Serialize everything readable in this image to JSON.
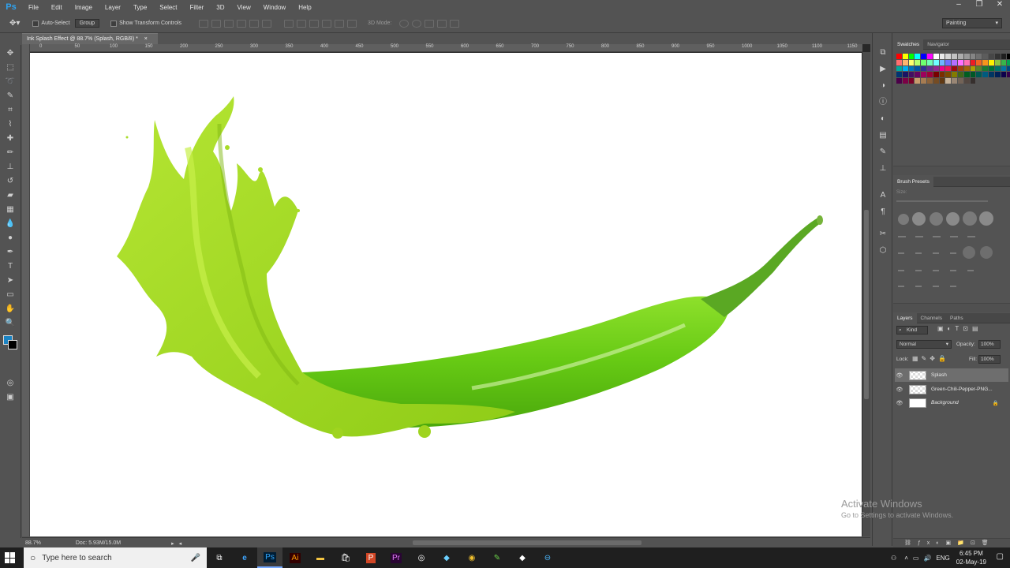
{
  "menubar": {
    "app_logo": "Ps",
    "items": [
      "File",
      "Edit",
      "Image",
      "Layer",
      "Type",
      "Select",
      "Filter",
      "3D",
      "View",
      "Window",
      "Help"
    ],
    "window_controls": [
      "–",
      "❐",
      "✕"
    ]
  },
  "options": {
    "auto_select_label": "Auto-Select",
    "group_value": "Group",
    "show_transform_label": "Show Transform Controls",
    "mode_3d_label": "3D Mode:",
    "workspace": "Painting"
  },
  "document": {
    "tab_title": "Ink Splash Effect @ 88.7% (Splash, RGB/8) *",
    "ruler_ticks": [
      "0",
      "50",
      "100",
      "150",
      "200",
      "250",
      "300",
      "350",
      "400",
      "450",
      "500",
      "550",
      "600",
      "650",
      "700",
      "750",
      "800",
      "850",
      "900",
      "950",
      "1000",
      "1050",
      "1100",
      "1150"
    ],
    "zoom": "88.7%",
    "doc_info": "Doc: 5.93M/15.0M"
  },
  "swatches": {
    "tabs": [
      "Swatches",
      "Navigator"
    ],
    "colors": [
      "#ff0000",
      "#ffff00",
      "#00ff00",
      "#00ffff",
      "#0000ff",
      "#ff00ff",
      "#ffffff",
      "#eaeaea",
      "#d6d6d6",
      "#c2c2c2",
      "#adadad",
      "#999999",
      "#858585",
      "#707070",
      "#5c5c5c",
      "#474747",
      "#333333",
      "#1f1f1f",
      "#000000",
      "#ff6f6f",
      "#ffb46f",
      "#ffff6f",
      "#b4ff6f",
      "#6fff6f",
      "#6fffb4",
      "#6fffff",
      "#6fb4ff",
      "#6f6fff",
      "#b46fff",
      "#ff6fff",
      "#ff6fb4",
      "#ed1c24",
      "#f26522",
      "#f7941d",
      "#fff200",
      "#8dc63f",
      "#39b54a",
      "#00a651",
      "#00a99d",
      "#00aeef",
      "#0072bc",
      "#0054a6",
      "#2e3192",
      "#662d91",
      "#92278f",
      "#ec008c",
      "#ed145b",
      "#9e0b0f",
      "#a0410d",
      "#a36209",
      "#aba000",
      "#598527",
      "#197b30",
      "#007236",
      "#00746b",
      "#0076a3",
      "#004a80",
      "#003471",
      "#1b1464",
      "#440e62",
      "#630460",
      "#9e005d",
      "#9e0039",
      "#790000",
      "#7b2e00",
      "#7d4900",
      "#827b00",
      "#406618",
      "#005e20",
      "#005826",
      "#005952",
      "#005b7f",
      "#003663",
      "#002157",
      "#0d004c",
      "#32004b",
      "#4b0049",
      "#7b0046",
      "#7a0026",
      "#c69c6d",
      "#a67c52",
      "#8c6239",
      "#754c24",
      "#603913",
      "#c7b299",
      "#998675",
      "#736357",
      "#534741",
      "#362f2d"
    ]
  },
  "brush_presets": {
    "title": "Brush Presets",
    "size_label": "Size:"
  },
  "layers": {
    "tabs": [
      "Layers",
      "Channels",
      "Paths"
    ],
    "kind_label": "Kind",
    "blend_mode": "Normal",
    "opacity_label": "Opacity:",
    "opacity_value": "100%",
    "lock_label": "Lock:",
    "fill_label": "Fill:",
    "fill_value": "100%",
    "items": [
      {
        "name": "Splash",
        "selected": true
      },
      {
        "name": "Green-Chili-Pepper-PNG...",
        "selected": false
      },
      {
        "name": "Background",
        "selected": false
      }
    ]
  },
  "watermark": {
    "line1": "Activate Windows",
    "line2": "Go to Settings to activate Windows."
  },
  "taskbar": {
    "search_placeholder": "Type here to search",
    "apps": [
      "Ps",
      "Ai",
      "Pr",
      "P"
    ],
    "lang": "ENG",
    "time": "6:45 PM",
    "date": "02-May-19"
  }
}
